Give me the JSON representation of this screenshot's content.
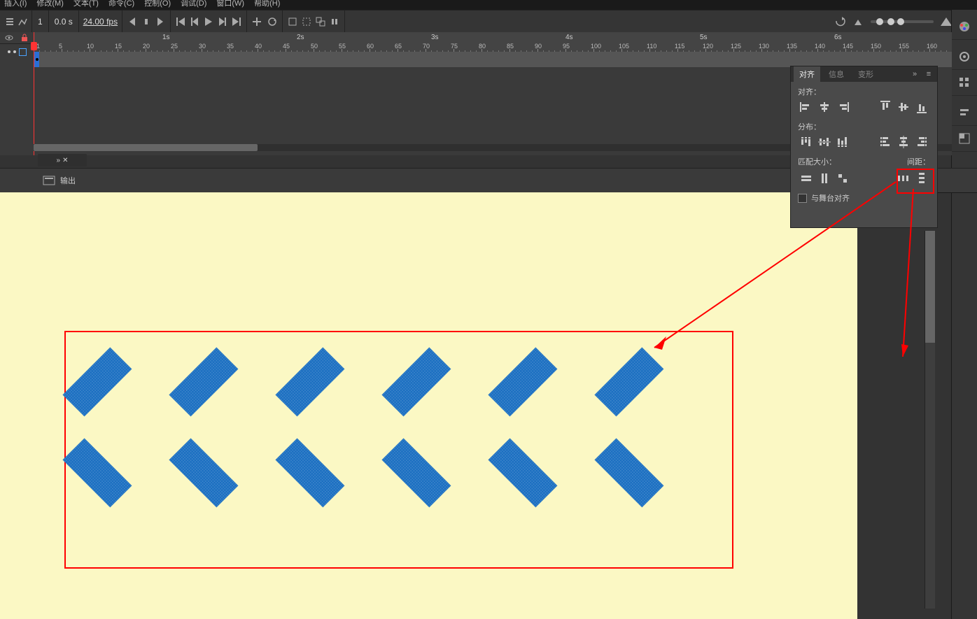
{
  "menu": {
    "items": [
      "插入(I)",
      "修改(M)",
      "文本(T)",
      "命令(C)",
      "控制(O)",
      "调试(D)",
      "窗口(W)",
      "帮助(H)"
    ]
  },
  "toolbar": {
    "frame": "1",
    "time": "0.0 s",
    "fps": "24.00 fps"
  },
  "timeline": {
    "seconds": [
      "1s",
      "2s",
      "3s",
      "4s",
      "5s",
      "6s"
    ],
    "frame_nums": [
      "1",
      "5",
      "10",
      "15",
      "20",
      "25",
      "30",
      "35",
      "40",
      "45",
      "50",
      "55",
      "60",
      "65",
      "70",
      "75",
      "80",
      "85",
      "90",
      "95",
      "100",
      "105",
      "110",
      "115",
      "120",
      "125",
      "130",
      "135",
      "140",
      "145",
      "150",
      "155",
      "160"
    ]
  },
  "output": {
    "label": "输出"
  },
  "align_panel": {
    "tabs": {
      "align": "对齐",
      "info": "信息",
      "transform": "变形"
    },
    "sec_align": "对齐：",
    "sec_distribute": "分布：",
    "sec_match": "匹配大小：",
    "sec_space": "间距：",
    "to_stage": "与舞台对齐"
  },
  "chevron_count": 6,
  "right_dock_icons": [
    "color",
    "properties",
    "library",
    "align",
    "swatches"
  ]
}
